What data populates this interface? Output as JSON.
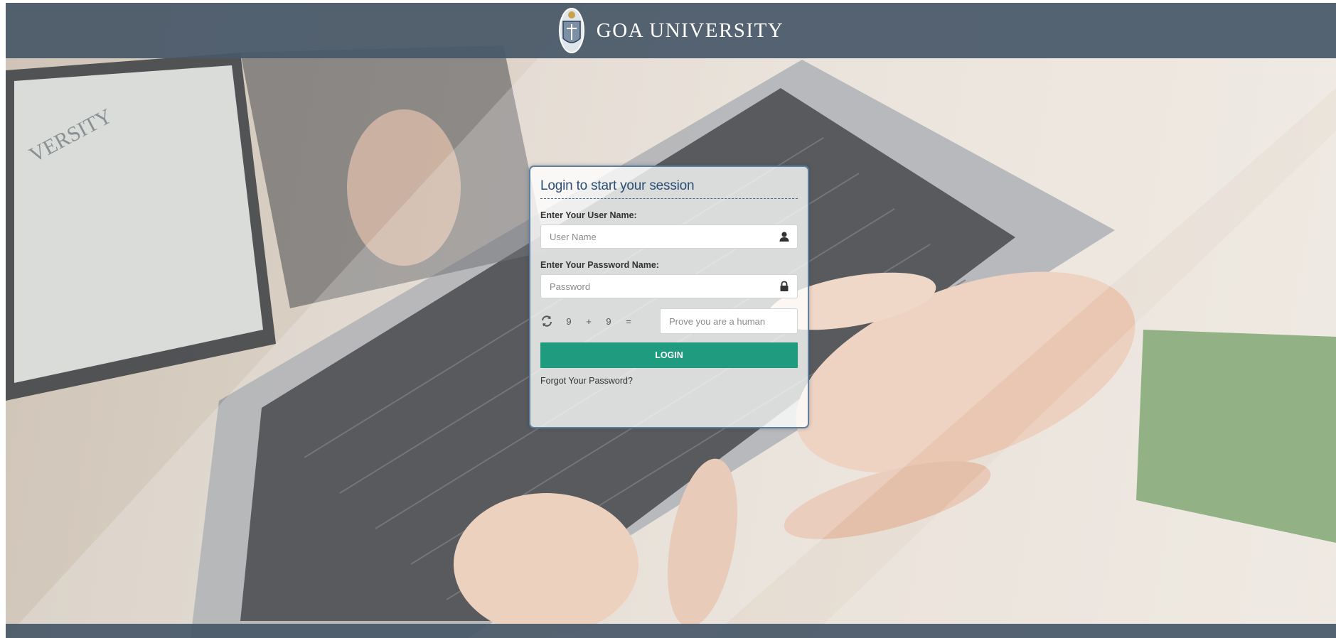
{
  "header": {
    "title": "GOA UNIVERSITY",
    "logo_icon": "university-crest-icon"
  },
  "background": {
    "laptop_screen_text": "VERSITY"
  },
  "login": {
    "heading": "Login to start your session",
    "username_label": "Enter Your User Name:",
    "username_placeholder": "User Name",
    "username_icon": "user-icon",
    "password_label": "Enter Your Password Name:",
    "password_placeholder": "Password",
    "password_icon": "lock-icon",
    "captcha": {
      "refresh_icon": "refresh-icon",
      "operand1": "9",
      "operator": "+",
      "operand2": "9",
      "equals": "=",
      "placeholder": "Prove you are a human"
    },
    "login_button": "LOGIN",
    "forgot_link": "Forgot Your Password?"
  },
  "colors": {
    "header_bg": "#485868",
    "heading": "#2b4f73",
    "button": "#1f9c80"
  }
}
